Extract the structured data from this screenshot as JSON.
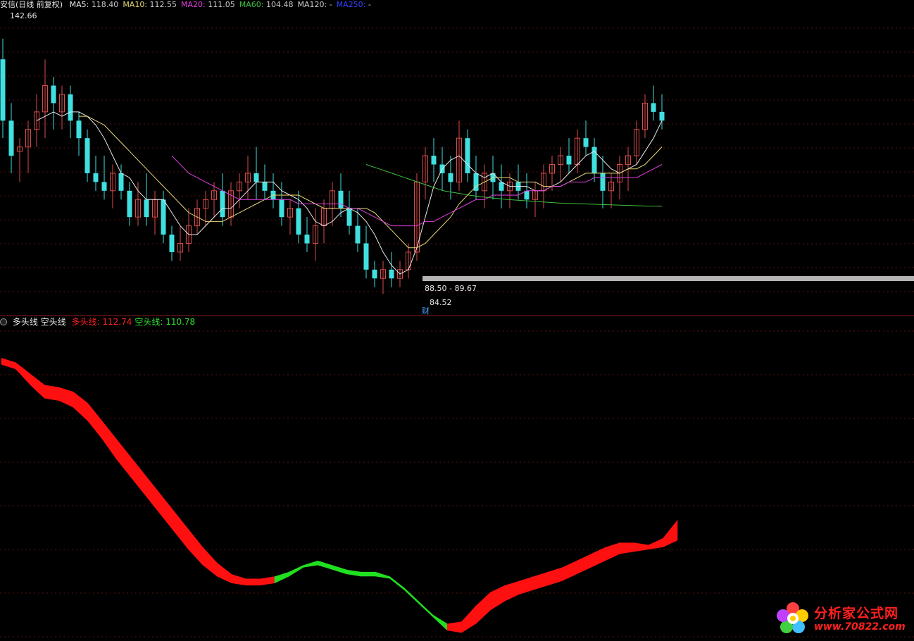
{
  "chart_data": [
    {
      "type": "candlestick",
      "title": "安信(日线 前复权)",
      "legend": [
        {
          "name": "MA5",
          "value": "118.40",
          "color": "#e8e8e8"
        },
        {
          "name": "MA10",
          "value": "112.55",
          "color": "#e8d878"
        },
        {
          "name": "MA20",
          "value": "111.05",
          "color": "#e040e0"
        },
        {
          "name": "MA60",
          "value": "104.48",
          "color": "#40c040"
        },
        {
          "name": "MA120",
          "value": "-",
          "color": "#cccccc"
        },
        {
          "name": "MA250",
          "value": "-",
          "color": "#3040ff"
        }
      ],
      "annotations": {
        "high": "142.66",
        "low": "84.52",
        "range": "88.50 - 89.67",
        "event_marker": "财"
      },
      "ylim": [
        80,
        148
      ],
      "up_color": "#d94c4c",
      "down_color": "#40e0e0",
      "candles": [
        [
          138,
          142.7,
          120,
          124
        ],
        [
          124,
          128,
          112,
          116
        ],
        [
          117,
          120,
          110,
          118
        ],
        [
          118,
          124,
          112,
          122
        ],
        [
          122,
          130,
          118,
          126
        ],
        [
          126,
          138,
          120,
          132
        ],
        [
          132,
          134,
          122,
          128
        ],
        [
          126,
          132,
          122,
          130
        ],
        [
          130,
          132,
          120,
          124
        ],
        [
          124,
          126,
          116,
          120
        ],
        [
          120,
          122,
          110,
          112
        ],
        [
          112,
          116,
          108,
          110
        ],
        [
          110,
          116,
          106,
          108
        ],
        [
          108,
          114,
          104,
          112
        ],
        [
          112,
          114,
          106,
          108
        ],
        [
          108,
          110,
          100,
          102
        ],
        [
          102,
          110,
          100,
          106
        ],
        [
          106,
          112,
          100,
          102
        ],
        [
          102,
          108,
          98,
          106
        ],
        [
          106,
          108,
          96,
          98
        ],
        [
          98,
          100,
          92,
          94
        ],
        [
          94,
          100,
          92,
          96
        ],
        [
          96,
          104,
          94,
          100
        ],
        [
          100,
          106,
          98,
          104
        ],
        [
          104,
          108,
          100,
          106
        ],
        [
          106,
          110,
          102,
          108
        ],
        [
          108,
          112,
          100,
          102
        ],
        [
          102,
          110,
          100,
          108
        ],
        [
          108,
          112,
          104,
          110
        ],
        [
          110,
          116,
          106,
          112
        ],
        [
          112,
          118,
          106,
          110
        ],
        [
          110,
          114,
          106,
          108
        ],
        [
          108,
          112,
          104,
          106
        ],
        [
          106,
          110,
          100,
          102
        ],
        [
          102,
          106,
          98,
          104
        ],
        [
          104,
          108,
          96,
          98
        ],
        [
          98,
          102,
          94,
          96
        ],
        [
          96,
          104,
          92,
          100
        ],
        [
          100,
          106,
          96,
          104
        ],
        [
          104,
          110,
          100,
          108
        ],
        [
          108,
          112,
          102,
          104
        ],
        [
          104,
          108,
          98,
          100
        ],
        [
          100,
          104,
          94,
          96
        ],
        [
          96,
          100,
          88,
          90
        ],
        [
          90,
          92,
          86,
          88
        ],
        [
          88,
          92,
          84.5,
          90
        ],
        [
          90,
          94,
          86,
          88
        ],
        [
          88,
          92,
          86,
          90
        ],
        [
          90,
          96,
          88,
          94
        ],
        [
          94,
          112,
          92,
          110
        ],
        [
          110,
          118,
          106,
          116
        ],
        [
          116,
          120,
          110,
          114
        ],
        [
          114,
          118,
          108,
          112
        ],
        [
          112,
          116,
          106,
          110
        ],
        [
          110,
          124,
          108,
          120
        ],
        [
          120,
          122,
          110,
          112
        ],
        [
          112,
          116,
          106,
          108
        ],
        [
          108,
          114,
          104,
          112
        ],
        [
          112,
          116,
          106,
          110
        ],
        [
          110,
          114,
          104,
          108
        ],
        [
          108,
          112,
          104,
          110
        ],
        [
          110,
          114,
          106,
          108
        ],
        [
          108,
          112,
          104,
          106
        ],
        [
          106,
          110,
          102,
          108
        ],
        [
          108,
          114,
          104,
          112
        ],
        [
          112,
          116,
          108,
          114
        ],
        [
          114,
          118,
          110,
          116
        ],
        [
          116,
          120,
          112,
          114
        ],
        [
          114,
          122,
          112,
          120
        ],
        [
          120,
          124,
          116,
          118
        ],
        [
          118,
          120,
          110,
          112
        ],
        [
          112,
          116,
          104,
          108
        ],
        [
          108,
          112,
          104,
          110
        ],
        [
          110,
          116,
          106,
          114
        ],
        [
          114,
          118,
          108,
          116
        ],
        [
          116,
          124,
          114,
          122
        ],
        [
          122,
          130,
          120,
          128
        ],
        [
          128,
          132,
          124,
          126
        ],
        [
          126,
          130,
          122,
          124
        ]
      ],
      "moving_averages": {
        "MA5": [
          null,
          null,
          null,
          null,
          124,
          125,
          126,
          125,
          126,
          126,
          125,
          123,
          120,
          116,
          112,
          111,
          108,
          106,
          106,
          106,
          103,
          100,
          98,
          98,
          100,
          102,
          104,
          104,
          106,
          108,
          110,
          110,
          110,
          108,
          107,
          106,
          104,
          101,
          100,
          101,
          103,
          104,
          103,
          101,
          98,
          94,
          91,
          89,
          90,
          95,
          102,
          109,
          113,
          115,
          116,
          114,
          112,
          111,
          112,
          110,
          109,
          109,
          109,
          108,
          108,
          109,
          110,
          112,
          114,
          116,
          117,
          115,
          113,
          112,
          113,
          114,
          117,
          120,
          124
        ],
        "MA10": [
          null,
          null,
          null,
          null,
          null,
          null,
          null,
          null,
          null,
          125,
          125,
          124,
          123,
          121,
          119,
          117,
          115,
          113,
          111,
          109,
          107,
          105,
          103,
          102,
          101,
          101,
          101,
          102,
          103,
          104,
          105,
          106,
          107,
          107,
          107,
          107,
          106,
          105,
          104,
          104,
          104,
          104,
          104,
          104,
          103,
          101,
          99,
          97,
          95,
          95,
          96,
          98,
          100,
          102,
          105,
          107,
          109,
          110,
          111,
          111,
          111,
          110,
          110,
          110,
          109,
          109,
          109,
          110,
          111,
          112,
          112,
          112,
          112,
          112,
          113,
          113,
          114,
          116,
          118
        ],
        "MA20": [
          null,
          null,
          null,
          null,
          null,
          null,
          null,
          null,
          null,
          null,
          null,
          null,
          null,
          null,
          null,
          null,
          null,
          null,
          null,
          null,
          116,
          114,
          112,
          111,
          110,
          109,
          108,
          107,
          106,
          106,
          106,
          106,
          106,
          106,
          106,
          105,
          105,
          105,
          105,
          105,
          105,
          104,
          104,
          103,
          102,
          101,
          100,
          100,
          100,
          100,
          101,
          101,
          102,
          103,
          104,
          105,
          106,
          106,
          107,
          107,
          107,
          107,
          108,
          108,
          108,
          109,
          109,
          110,
          110,
          110,
          111,
          111,
          111,
          111,
          111,
          111,
          112,
          113,
          114
        ],
        "MA60": [
          null,
          null,
          null,
          null,
          null,
          null,
          null,
          null,
          null,
          null,
          null,
          null,
          null,
          null,
          null,
          null,
          null,
          null,
          null,
          null,
          null,
          null,
          null,
          null,
          null,
          null,
          null,
          null,
          null,
          null,
          null,
          null,
          null,
          null,
          null,
          null,
          null,
          null,
          null,
          null,
          null,
          null,
          null,
          null,
          null,
          null,
          null,
          null,
          null,
          null,
          null,
          null,
          null,
          null,
          null,
          null,
          null,
          null,
          null,
          null,
          null,
          null,
          null,
          null,
          null,
          null,
          null,
          null,
          null,
          null,
          null,
          null,
          null,
          null,
          null,
          null,
          null,
          null,
          null
        ]
      },
      "ma60_series": [
        114,
        113,
        112,
        111,
        110,
        109,
        108,
        107.5,
        107,
        106.6,
        106.3,
        106,
        105.8,
        105.6,
        105.4,
        105.2,
        105.1,
        105,
        104.9,
        104.8,
        104.7,
        104.6,
        104.5,
        104.48
      ]
    },
    {
      "type": "area",
      "title": "多头线 空头线",
      "legend": [
        {
          "name": "多头线",
          "value": "112.74",
          "color": "#ff2020"
        },
        {
          "name": "空头线",
          "value": "110.78",
          "color": "#30e030"
        }
      ],
      "ylim": [
        80,
        148
      ],
      "bull": [
        142,
        141,
        138.5,
        136,
        135.5,
        134.5,
        132,
        128,
        124,
        120,
        116,
        112,
        108,
        104,
        100,
        96.5,
        94,
        93,
        93,
        93.5,
        94.5,
        96,
        97,
        96,
        95,
        94.5,
        94.5,
        93.5,
        91,
        88,
        85,
        83,
        83.5,
        87,
        90,
        91.5,
        92.5,
        93.5,
        94.5,
        95.5,
        97,
        98.5,
        100,
        101,
        101,
        100.5,
        102,
        106
      ],
      "bear": [
        142,
        141,
        137.5,
        134.5,
        134,
        132.5,
        129.5,
        125.5,
        121,
        117,
        113,
        109,
        105,
        101,
        97.5,
        95,
        93.5,
        93,
        93,
        93.5,
        95,
        97,
        97.5,
        96.5,
        95.5,
        95,
        95,
        94.5,
        92,
        89,
        86,
        83,
        82.5,
        84.5,
        87.5,
        89.5,
        91,
        92,
        93,
        94,
        95.5,
        97,
        98.5,
        100,
        100.5,
        101,
        101.5,
        103
      ]
    }
  ],
  "watermark": {
    "title": "分析家公式网",
    "url": "www.70822.com"
  }
}
